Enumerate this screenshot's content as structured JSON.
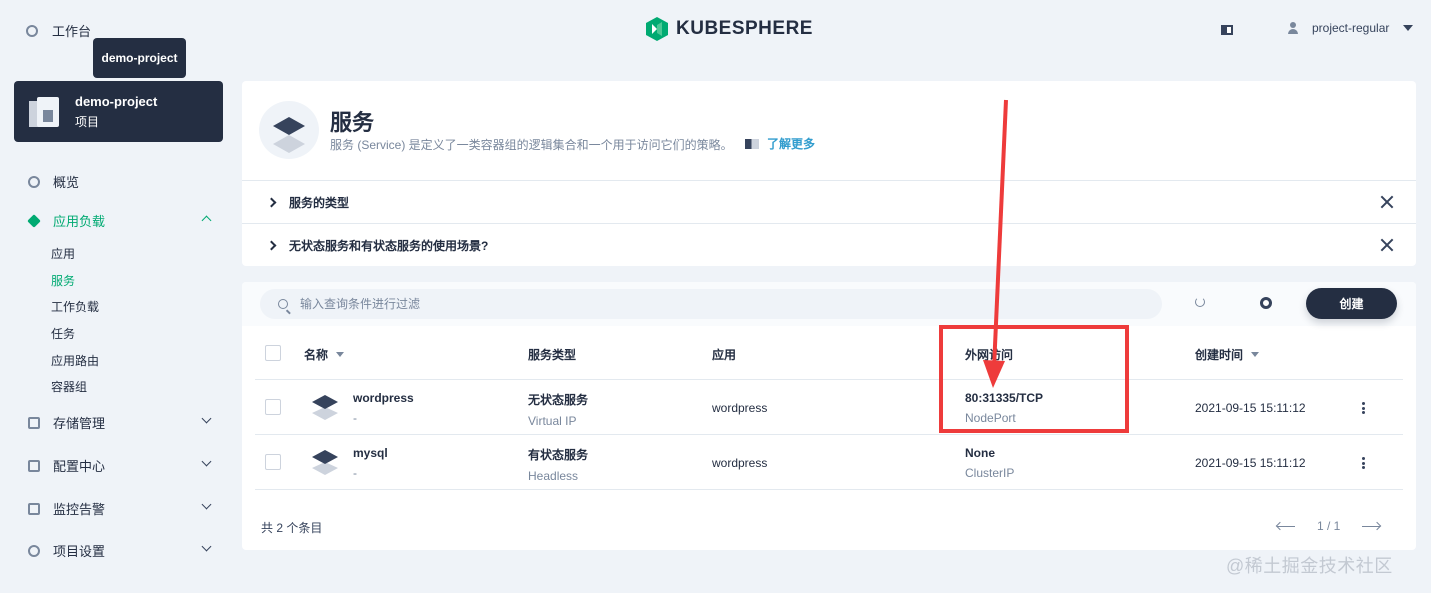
{
  "topbar": {
    "workbench_label": "工作台",
    "logo_text": "KUBESPHERE",
    "username": "project-regular"
  },
  "tooltip": "demo-project",
  "project": {
    "name": "demo-project",
    "type": "项目"
  },
  "sidebar": {
    "items": [
      {
        "label": "概览"
      },
      {
        "label": "应用负载",
        "active": true,
        "children": [
          "应用",
          "服务",
          "工作负载",
          "任务",
          "应用路由",
          "容器组"
        ],
        "active_child": "服务"
      },
      {
        "label": "存储管理"
      },
      {
        "label": "配置中心"
      },
      {
        "label": "监控告警"
      },
      {
        "label": "项目设置"
      }
    ]
  },
  "header": {
    "title": "服务",
    "description": "服务 (Service) 是定义了一类容器组的逻辑集合和一个用于访问它们的策略。",
    "learn_more": "了解更多",
    "faqs": [
      "服务的类型",
      "无状态服务和有状态服务的使用场景?"
    ]
  },
  "table": {
    "search_placeholder": "输入查询条件进行过滤",
    "create_label": "创建",
    "columns": [
      "名称",
      "服务类型",
      "应用",
      "外网访问",
      "创建时间"
    ],
    "rows": [
      {
        "name": "wordpress",
        "name_sub": "-",
        "type": "无状态服务",
        "type_sub": "Virtual IP",
        "app": "wordpress",
        "access": "80:31335/TCP",
        "access_sub": "NodePort",
        "created": "2021-09-15 15:11:12"
      },
      {
        "name": "mysql",
        "name_sub": "-",
        "type": "有状态服务",
        "type_sub": "Headless",
        "app": "wordpress",
        "access": "None",
        "access_sub": "ClusterIP",
        "created": "2021-09-15 15:11:12"
      }
    ],
    "total": "共 2 个条目",
    "page": "1 / 1"
  },
  "watermark": "@稀土掘金技术社区",
  "colors": {
    "accent": "#00aa72",
    "dark": "#242e42",
    "annotation": "#ee3b3b",
    "bg": "#eff3f8"
  }
}
